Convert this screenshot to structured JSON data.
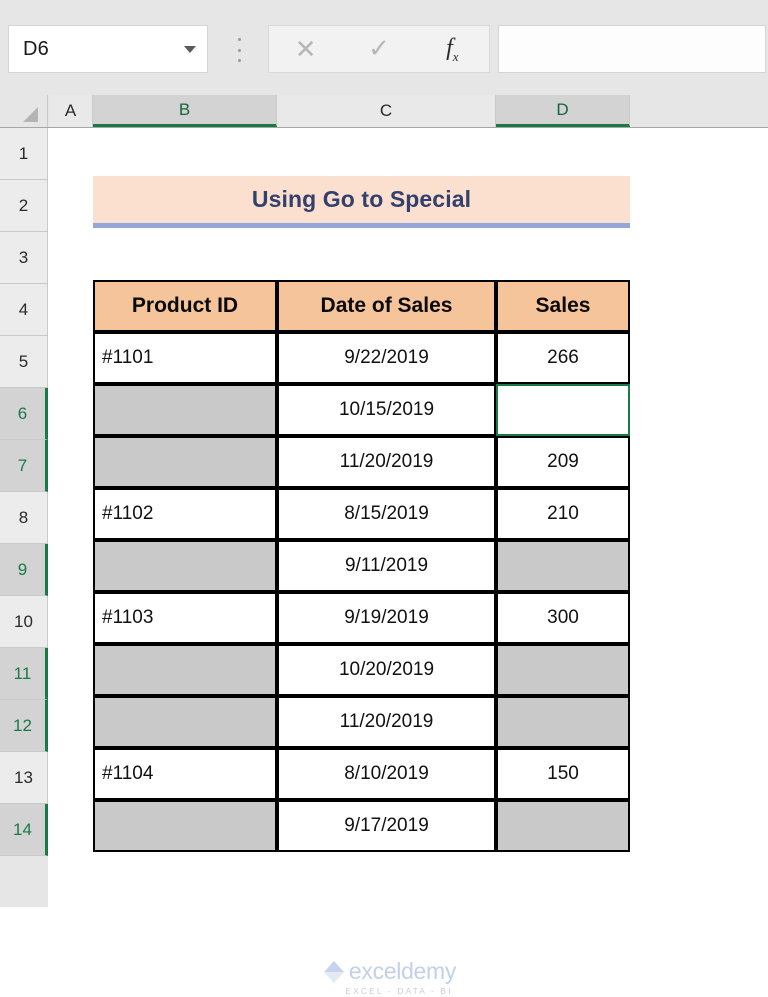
{
  "formula_bar": {
    "name_box_value": "D6",
    "name_box_dropdown_icon": "chevron-down-icon",
    "kebab_icon": "more-options-icon",
    "cancel_icon": "✕",
    "enter_icon": "✓",
    "insert_function_icon": "fx",
    "insert_function_label": "f",
    "insert_function_sub": "x",
    "formula_value": ""
  },
  "grid": {
    "select_all_icon": "select-all-triangle-icon",
    "columns": [
      {
        "label": "A",
        "selected": false
      },
      {
        "label": "B",
        "selected": true
      },
      {
        "label": "C",
        "selected": false
      },
      {
        "label": "D",
        "selected": true
      }
    ],
    "rows": [
      {
        "label": "1",
        "selected": false
      },
      {
        "label": "2",
        "selected": false
      },
      {
        "label": "3",
        "selected": false
      },
      {
        "label": "4",
        "selected": false
      },
      {
        "label": "5",
        "selected": false
      },
      {
        "label": "6",
        "selected": true
      },
      {
        "label": "7",
        "selected": true
      },
      {
        "label": "8",
        "selected": false
      },
      {
        "label": "9",
        "selected": true
      },
      {
        "label": "10",
        "selected": false
      },
      {
        "label": "11",
        "selected": true
      },
      {
        "label": "12",
        "selected": true
      },
      {
        "label": "13",
        "selected": false
      },
      {
        "label": "14",
        "selected": true
      }
    ]
  },
  "sheet": {
    "title": "Using Go to Special",
    "table_headers": [
      "Product ID",
      "Date of Sales",
      "Sales"
    ],
    "table_rows": [
      {
        "product_id": "#1101",
        "date": "9/22/2019",
        "sales": "266"
      },
      {
        "product_id": "",
        "date": "10/15/2019",
        "sales": ""
      },
      {
        "product_id": "",
        "date": "11/20/2019",
        "sales": "209"
      },
      {
        "product_id": "#1102",
        "date": "8/15/2019",
        "sales": "210"
      },
      {
        "product_id": "",
        "date": "9/11/2019",
        "sales": ""
      },
      {
        "product_id": "#1103",
        "date": "9/19/2019",
        "sales": "300"
      },
      {
        "product_id": "",
        "date": "10/20/2019",
        "sales": ""
      },
      {
        "product_id": "",
        "date": "11/20/2019",
        "sales": ""
      },
      {
        "product_id": "#1104",
        "date": "8/10/2019",
        "sales": "150"
      },
      {
        "product_id": "",
        "date": "9/17/2019",
        "sales": ""
      }
    ],
    "active_cell": "D6"
  },
  "watermark": {
    "name": "exceldemy",
    "tagline": "EXCEL - DATA - BI",
    "logo_icon": "exceldemy-cube-logo-icon"
  },
  "colors": {
    "header_fill": "#f5c49a",
    "title_fill": "#fbe0d0",
    "title_underline": "#93a7da",
    "blank_fill": "#c9c9c9",
    "selection_green": "#1a7a46",
    "title_text": "#33406b"
  }
}
